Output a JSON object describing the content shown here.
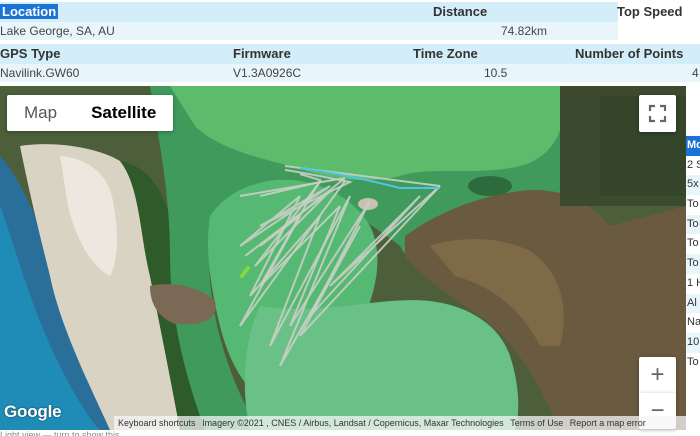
{
  "summary": {
    "row1": {
      "location_label": "Location",
      "distance_label": "Distance",
      "top_speed_label": "Top Speed",
      "location_value": "Lake George, SA, AU",
      "distance_value": "74.82km"
    },
    "row2": {
      "gps_type_label": "GPS Type",
      "firmware_label": "Firmware",
      "timezone_label": "Time Zone",
      "points_label": "Number of Points",
      "gps_type_value": "Navilink.GW60",
      "firmware_value": "V1.3A0926C",
      "timezone_value": "10.5",
      "points_value": "4"
    }
  },
  "map": {
    "map_type_map": "Map",
    "map_type_satellite": "Satellite",
    "zoom_in": "+",
    "zoom_out": "−",
    "google_logo": "Google",
    "attribution": {
      "shortcuts": "Keyboard shortcuts",
      "imagery": "Imagery ©2021 , CNES / Airbus, Landsat / Copernicus, Maxar Technologies",
      "terms": "Terms of Use",
      "report": "Report a map error"
    },
    "colors": {
      "track": "#c9cfc4",
      "track_highlight": "#4fc3e8",
      "track_start": "#7ddc3a"
    }
  },
  "side_list": [
    "Mo",
    "2 S",
    "5x",
    "To",
    "To",
    "To",
    "To",
    "1 H",
    "Al",
    "Na",
    "10",
    "To"
  ],
  "footer_text": "Light view — turn to show this"
}
